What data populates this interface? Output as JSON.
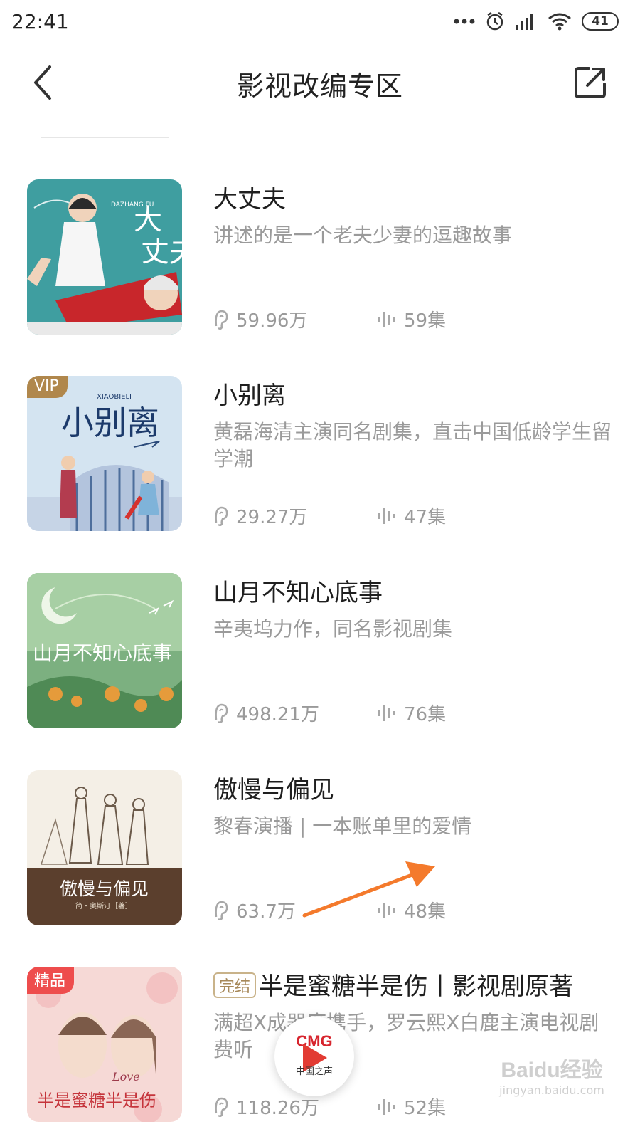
{
  "status_bar": {
    "time": "22:41",
    "battery": "41"
  },
  "header": {
    "title": "影视改编专区"
  },
  "items": [
    {
      "title": "大丈夫",
      "desc": "讲述的是一个老夫少妻的逗趣故事",
      "plays": "59.96万",
      "episodes": "59集",
      "cover_text": "大丈夫",
      "cover_subtext": "DAZHANG FU"
    },
    {
      "badge": "VIP",
      "title": "小别离",
      "desc": "黄磊海清主演同名剧集，直击中国低龄学生留学潮",
      "plays": "29.27万",
      "episodes": "47集",
      "cover_text": "小别离",
      "cover_subtext": "XIAOBIELI"
    },
    {
      "title": "山月不知心底事",
      "desc": "辛夷坞力作，同名影视剧集",
      "plays": "498.21万",
      "episodes": "76集",
      "cover_text": "山月不知心底事"
    },
    {
      "title": "傲慢与偏见",
      "desc": "黎春演播 | 一本账单里的爱情",
      "plays": "63.7万",
      "episodes": "48集",
      "cover_text": "傲慢与偏见",
      "cover_subtext": "简・奥斯汀［著］"
    },
    {
      "badge": "精品",
      "tag": "完结",
      "title": "半是蜜糖半是伤丨影视剧原著",
      "desc": "满超X成器度携手，罗云熙X白鹿主演电视剧费听",
      "plays": "118.26万",
      "episodes": "52集",
      "cover_text": "半是蜜糖半是伤",
      "cover_subtext": "Love"
    }
  ],
  "mini_player": {
    "brand": "CMG",
    "subtitle": "中国之声"
  },
  "watermark": {
    "main": "Baidu经验",
    "sub": "jingyan.baidu.com"
  },
  "colors": {
    "accent": "#f47a2c",
    "secondary_text": "#9a9a9a",
    "vip_badge": "#b0874c",
    "premium_badge": "#ee4d4d"
  }
}
